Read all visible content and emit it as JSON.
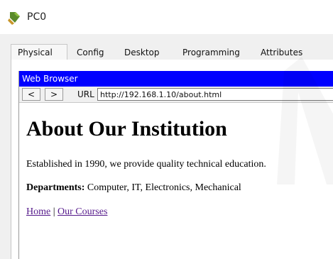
{
  "window": {
    "title": "PC0",
    "icon": "pc-device-icon"
  },
  "tabs": [
    {
      "label": "Physical"
    },
    {
      "label": "Config"
    },
    {
      "label": "Desktop",
      "active": true
    },
    {
      "label": "Programming"
    },
    {
      "label": "Attributes"
    }
  ],
  "browser": {
    "title": "Web Browser",
    "back_label": "<",
    "forward_label": ">",
    "url_label": "URL",
    "url_value": "http://192.168.1.10/about.html"
  },
  "page": {
    "heading": "About Our Institution",
    "intro": "Established in 1990, we provide quality technical education.",
    "departments_label": "Departments:",
    "departments_value": " Computer, IT, Electronics, Mechanical",
    "links": [
      {
        "label": "Home"
      },
      {
        "label": "Our Courses"
      }
    ],
    "link_separator": " | "
  },
  "colors": {
    "browser_titlebar": "#0000ff",
    "active_tab_underline": "#1f3f7a",
    "visited_link": "#551a8b"
  }
}
